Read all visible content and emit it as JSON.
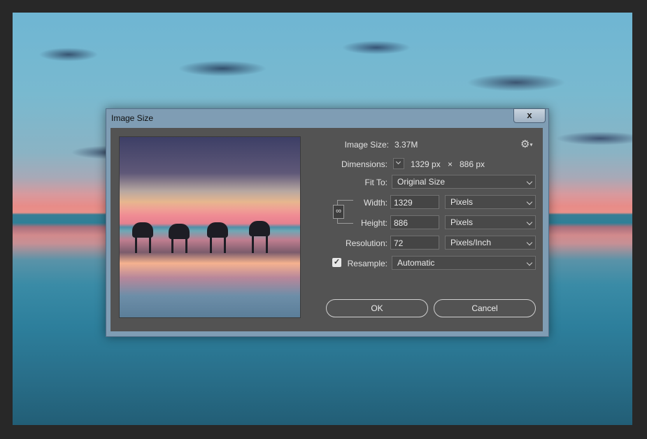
{
  "dialog": {
    "title": "Image Size",
    "close_label": "x"
  },
  "info": {
    "image_size_label": "Image Size:",
    "image_size_value": "3.37M",
    "dimensions_label": "Dimensions:",
    "dimensions_width": "1329 px",
    "dimensions_times": "×",
    "dimensions_height": "886 px"
  },
  "fit_to": {
    "label": "Fit To:",
    "value": "Original Size"
  },
  "width": {
    "label": "Width:",
    "value": "1329",
    "unit": "Pixels"
  },
  "height": {
    "label": "Height:",
    "value": "886",
    "unit": "Pixels"
  },
  "resolution": {
    "label": "Resolution:",
    "value": "72",
    "unit": "Pixels/Inch"
  },
  "resample": {
    "label": "Resample:",
    "checked": true,
    "value": "Automatic"
  },
  "buttons": {
    "ok": "OK",
    "cancel": "Cancel"
  },
  "icons": {
    "settings": "gear-icon",
    "dimensions_dropdown": "chevron-down-icon",
    "constrain": "chain-link-icon",
    "checkbox": "checkmark-icon"
  },
  "colors": {
    "panel_bg": "#535353",
    "dialog_frame": "#7f9db4",
    "text": "#e2e2e2"
  }
}
